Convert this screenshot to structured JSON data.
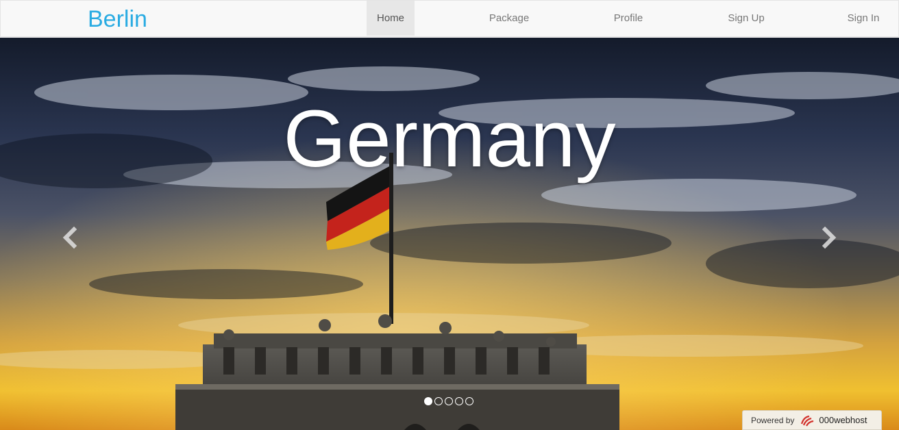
{
  "navbar": {
    "brand": "Berlin",
    "items": [
      {
        "label": "Home",
        "active": true
      },
      {
        "label": "Package",
        "active": false
      },
      {
        "label": "Profile",
        "active": false
      },
      {
        "label": "Sign Up",
        "active": false
      },
      {
        "label": "Sign In",
        "active": false
      }
    ]
  },
  "carousel": {
    "caption": "Germany",
    "slide_count": 5,
    "active_slide": 1,
    "prev_icon": "chevron-left-icon",
    "next_icon": "chevron-right-icon"
  },
  "badge": {
    "powered_text": "Powered by",
    "host_text": "000webhost"
  },
  "colors": {
    "brand": "#29abe2",
    "nav_bg": "#f8f8f8",
    "nav_active_bg": "#e7e7e7",
    "nav_text": "#777777"
  }
}
